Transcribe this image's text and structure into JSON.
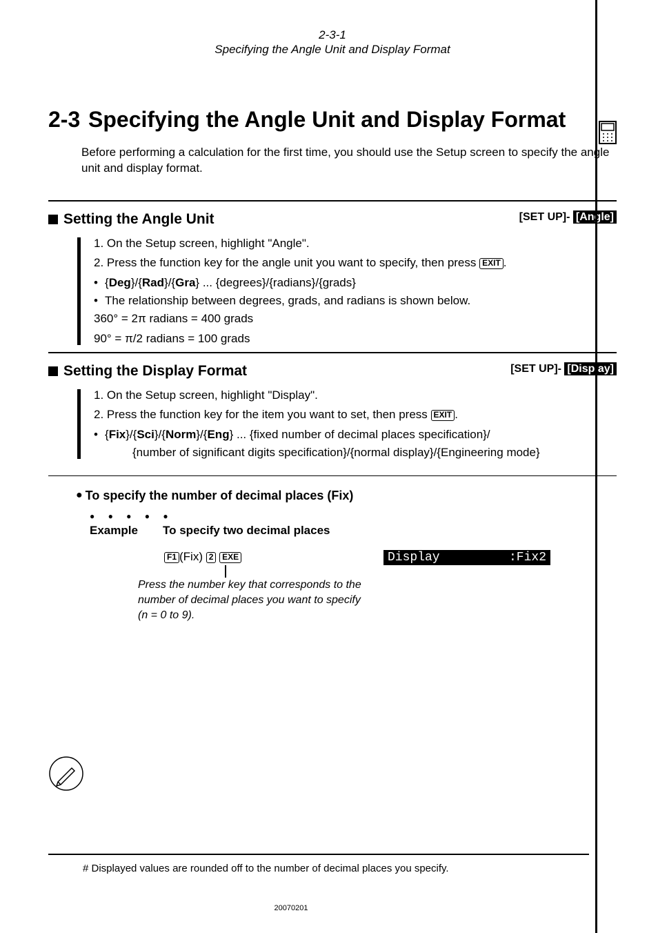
{
  "header": {
    "num": "2-3-1",
    "title": "Specifying the Angle Unit and Display Format"
  },
  "h1": {
    "num": "2-3",
    "text": "Specifying the Angle Unit and Display Format"
  },
  "intro": "Before performing a calculation for the first time, you should use the Setup screen to specify the angle unit and display format.",
  "sec1": {
    "title": "Setting the Angle Unit",
    "right_plain": "[SET UP]- ",
    "right_inv": "[Angle]",
    "step1": "1. On the Setup screen, highlight \"Angle\".",
    "step2a": "2. Press the function key for the angle unit you want to specify, then press ",
    "key_exit": "EXIT",
    "step2b": ".",
    "bul1a": "{",
    "bul1b": "Deg",
    "bul1c": "}/{",
    "bul1d": "Rad",
    "bul1e": "}/{",
    "bul1f": "Gra",
    "bul1g": "} ... {degrees}/{radians}/{grads}",
    "bul2": "The relationship between degrees, grads, and radians is shown below.",
    "eq1": "360° = 2π radians = 400 grads",
    "eq2": "90° = π/2 radians = 100 grads"
  },
  "sec2": {
    "title": "Setting the Display Format",
    "right_plain": "[SET UP]- ",
    "right_inv": "[Display]",
    "step1": "1. On the Setup screen, highlight \"Display\".",
    "step2a": "2. Press the function key for the item you want to set, then press ",
    "key_exit": "EXIT",
    "step2b": ".",
    "bul1_pre": "{",
    "b1": "Fix",
    "m1": "}/{",
    "b2": "Sci",
    "m2": "}/{",
    "b3": "Norm",
    "m3": "}/{",
    "b4": "Eng",
    "bul1_post": "} ... {fixed number of decimal places specification}/",
    "bul1_line2": "{number of significant digits specification}/{normal display}/{Engineering mode}"
  },
  "sub": {
    "title": "To specify the number of decimal places (Fix)",
    "ex_label": "Example",
    "ex_text": "To specify two decimal places",
    "key_f1": "F1",
    "key_fix": "(Fix)",
    "key_2": "2",
    "key_exe": "EXE",
    "calc_left": "Display",
    "calc_right": ":Fix2",
    "note1": "Press the number key that corresponds to the",
    "note2": "number of decimal places you want to specify",
    "note3a": "(",
    "note3b": "n",
    "note3c": " = 0 to 9)."
  },
  "footnote": "# Displayed values are rounded off to the number of decimal places you specify.",
  "date": "20070201"
}
